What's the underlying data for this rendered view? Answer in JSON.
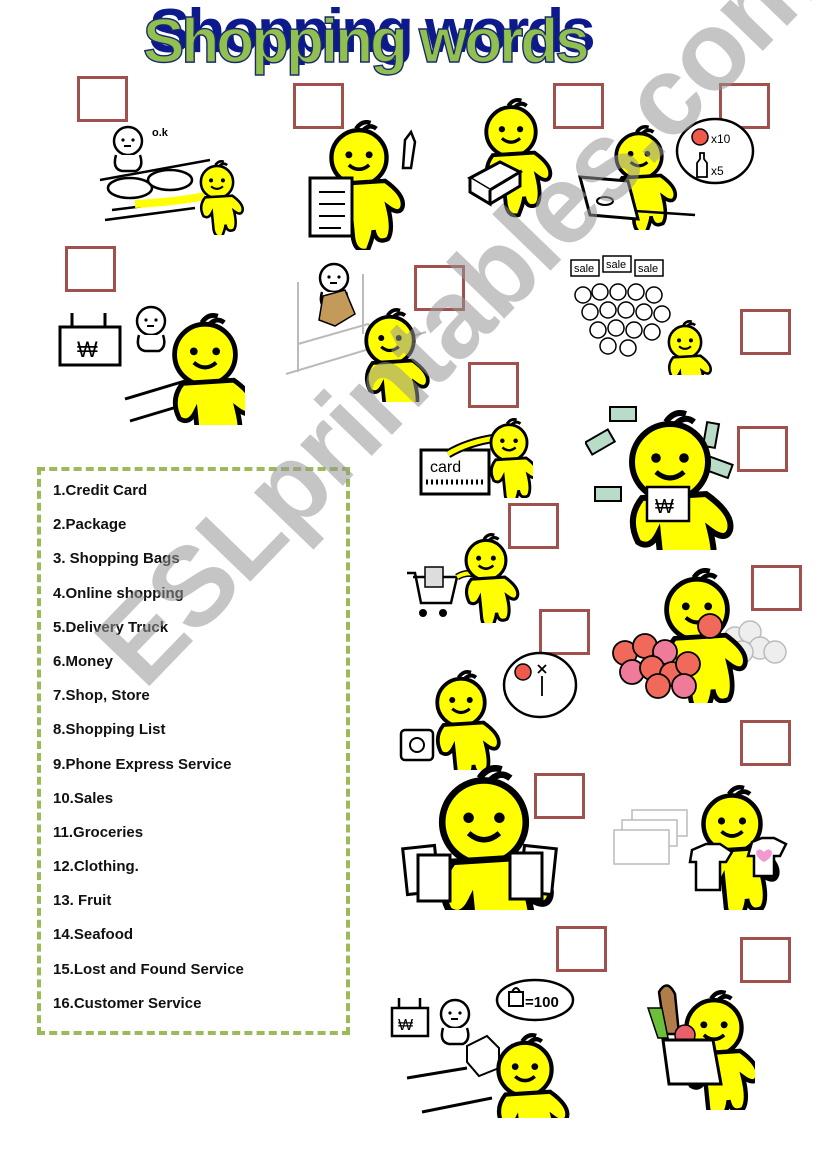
{
  "worksheet": {
    "title": "Shopping words",
    "watermark": "ESLprintables.com",
    "colors": {
      "title_fill": "#92c050",
      "title_shadow": "#0d1a8c",
      "answer_box_border": "#a0504d",
      "word_list_border": "#9bbb59",
      "character_yellow": "#ffff00"
    },
    "word_list": [
      "1.Credit Card",
      "2.Package",
      "3. Shopping Bags",
      "4.Online shopping",
      "5.Delivery Truck",
      "6.Money",
      "7.Shop, Store",
      "8.Shopping List",
      "9.Phone Express Service",
      "10.Sales",
      "11.Groceries",
      "12.Clothing.",
      "13. Fruit",
      "14.Seafood",
      "15.Lost and Found Service",
      "16.Customer Service"
    ],
    "illustrations": [
      {
        "id": "seafood-counter",
        "texts": [
          "o.k"
        ]
      },
      {
        "id": "shopping-list"
      },
      {
        "id": "package"
      },
      {
        "id": "online-shopping",
        "texts": [
          "x10",
          "x5"
        ]
      },
      {
        "id": "shop-store-counter",
        "texts": [
          "₩"
        ]
      },
      {
        "id": "lost-and-found"
      },
      {
        "id": "sales-crowd",
        "texts": [
          "sale",
          "sale",
          "sale"
        ]
      },
      {
        "id": "credit-card",
        "texts": [
          "card"
        ]
      },
      {
        "id": "money",
        "texts": [
          "₩"
        ]
      },
      {
        "id": "groceries-cart"
      },
      {
        "id": "fruit"
      },
      {
        "id": "phone-express"
      },
      {
        "id": "shopping-bags"
      },
      {
        "id": "clothing"
      },
      {
        "id": "customer-service",
        "texts": [
          "=100",
          "₩"
        ]
      },
      {
        "id": "grocery-bag"
      }
    ]
  }
}
